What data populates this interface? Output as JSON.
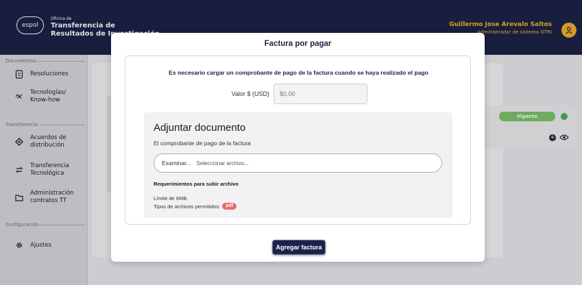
{
  "header": {
    "logo_text": "espol",
    "org_small": "Oficina de",
    "org_line1": "Transferencia de",
    "org_line2": "Resultados de Investigación",
    "user_name": "Guillermo Jose Arevalo Saltos",
    "user_role": "Administrador de sistema OTRI"
  },
  "sidebar": {
    "sections": [
      {
        "label": "Documentos",
        "items": [
          {
            "label": "Resoluciones",
            "icon": "document-icon"
          },
          {
            "label": "Tecnologías/\nKnow-how",
            "icon": "handshake-icon"
          }
        ]
      },
      {
        "label": "Transferencia",
        "items": [
          {
            "label": "Acuerdos de\ndistribución",
            "icon": "share-icon"
          },
          {
            "label": "Transferencia\nTecnológica",
            "icon": "swap-icon"
          },
          {
            "label": "Administración\ncontratos TT",
            "icon": "folder-icon"
          }
        ]
      },
      {
        "label": "Configuración",
        "items": [
          {
            "label": "Ajustes",
            "icon": "gear-icon"
          }
        ]
      }
    ]
  },
  "background": {
    "status_badge": "Vigente"
  },
  "modal": {
    "title": "Factura por pagar",
    "notice": "Es necesario cargar un comprobante de pago de la factura cuando se haya realizado el pago",
    "valor_label": "Valor $ (USD)",
    "valor_placeholder": "$0.00",
    "attach_title": "Adjuntar documento",
    "attach_subtitle": "El comprobante de pago de la factura",
    "examinar_label": "Examinar...",
    "file_placeholder": "Seleccionar archivo...",
    "requirements_title": "Requerimientos para subir archivo",
    "size_limit": "Límite de 6MB.",
    "types_label": "Tipos de archivos permitidos:",
    "types_badge": "pdf",
    "submit_label": "Agregar factura"
  },
  "colors": {
    "primary": "#1d2348",
    "accent": "#f5b82b",
    "success": "#7dc36b",
    "pdf_badge": "#e86a6a"
  }
}
